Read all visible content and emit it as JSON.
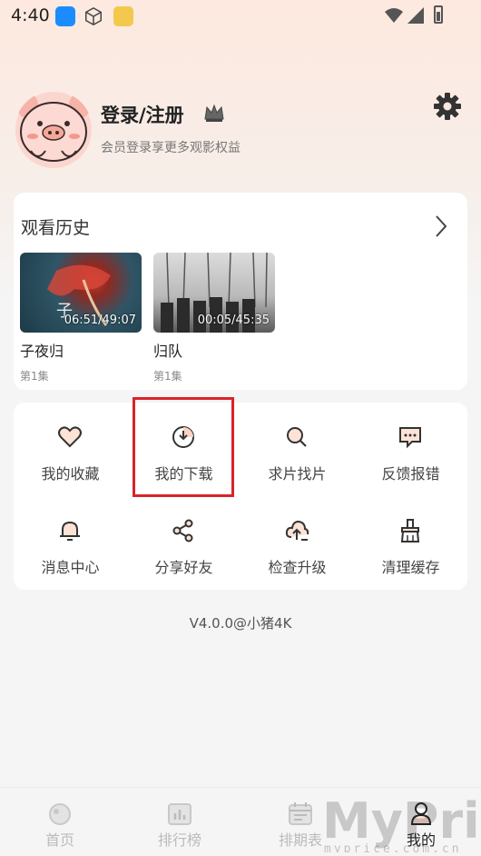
{
  "status_bar": {
    "time": "4:40"
  },
  "profile": {
    "title": "登录/注册",
    "subtitle": "会员登录享更多观影权益"
  },
  "history": {
    "title": "观看历史",
    "items": [
      {
        "title": "子夜归",
        "episode": "第1集",
        "progress": "06:51/49:07"
      },
      {
        "title": "归队",
        "episode": "第1集",
        "progress": "00:05/45:35"
      }
    ]
  },
  "functions": [
    {
      "label": "我的收藏",
      "icon": "heart-icon"
    },
    {
      "label": "我的下载",
      "icon": "download-icon"
    },
    {
      "label": "求片找片",
      "icon": "search-icon"
    },
    {
      "label": "反馈报错",
      "icon": "feedback-icon"
    },
    {
      "label": "消息中心",
      "icon": "bell-icon"
    },
    {
      "label": "分享好友",
      "icon": "share-icon"
    },
    {
      "label": "检查升级",
      "icon": "upgrade-icon"
    },
    {
      "label": "清理缓存",
      "icon": "clean-icon"
    }
  ],
  "version": "V4.0.0@小猪4K",
  "bottom_nav": [
    {
      "label": "首页",
      "icon": "home-icon",
      "active": false
    },
    {
      "label": "排行榜",
      "icon": "ranking-icon",
      "active": false
    },
    {
      "label": "排期表",
      "icon": "schedule-icon",
      "active": false
    },
    {
      "label": "我的",
      "icon": "profile-icon",
      "active": true
    }
  ],
  "watermark": {
    "main": "MyPrice",
    "sub": "myprice.com.cn"
  },
  "colors": {
    "accent": "#f08a5d",
    "highlight_border": "#d9232b"
  }
}
